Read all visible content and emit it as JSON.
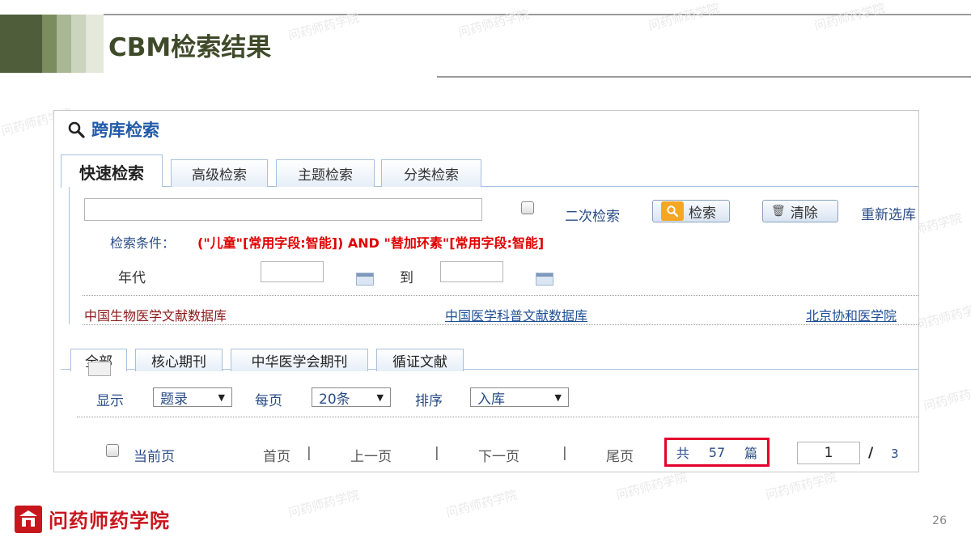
{
  "slide": {
    "title": "CBM检索结果",
    "page_number": "26",
    "watermark": "问药师药学院",
    "logo_text": "问药师药学院"
  },
  "panel": {
    "title": "跨库检索",
    "tabs": [
      "快速检索",
      "高级检索",
      "主题检索",
      "分类检索"
    ],
    "search_input_value": "",
    "secondary_search_label": "二次检索",
    "search_button": "检索",
    "clear_button": "清除",
    "reselect_link": "重新选库",
    "condition_label": "检索条件：",
    "condition_value": "(\"儿童\"[常用字段:智能]) AND \"替加环素\"[常用字段:智能]",
    "year_label": "年代",
    "year_from": "",
    "to_label": "到",
    "year_to": "",
    "databases": [
      "中国生物医学文献数据库",
      "中国医学科普文献数据库",
      "北京协和医学院"
    ],
    "result_tabs": [
      "全部",
      "核心期刊",
      "中华医学会期刊",
      "循证文献"
    ],
    "display_label": "显示",
    "display_value": "题录",
    "per_page_label": "每页",
    "per_page_value": "20条",
    "sort_label": "排序",
    "sort_value": "入库",
    "current_page_label": "当前页",
    "first_page": "首页",
    "prev_page": "上一页",
    "next_page": "下一页",
    "last_page": "尾页",
    "total_prefix": "共",
    "total_count": "57",
    "total_suffix": "篇",
    "page_input_value": "1",
    "page_total": "3"
  },
  "colors": {
    "accent_red": "#e3002d",
    "link_blue": "#2a4d87",
    "header_green": "#4f5d3a"
  }
}
